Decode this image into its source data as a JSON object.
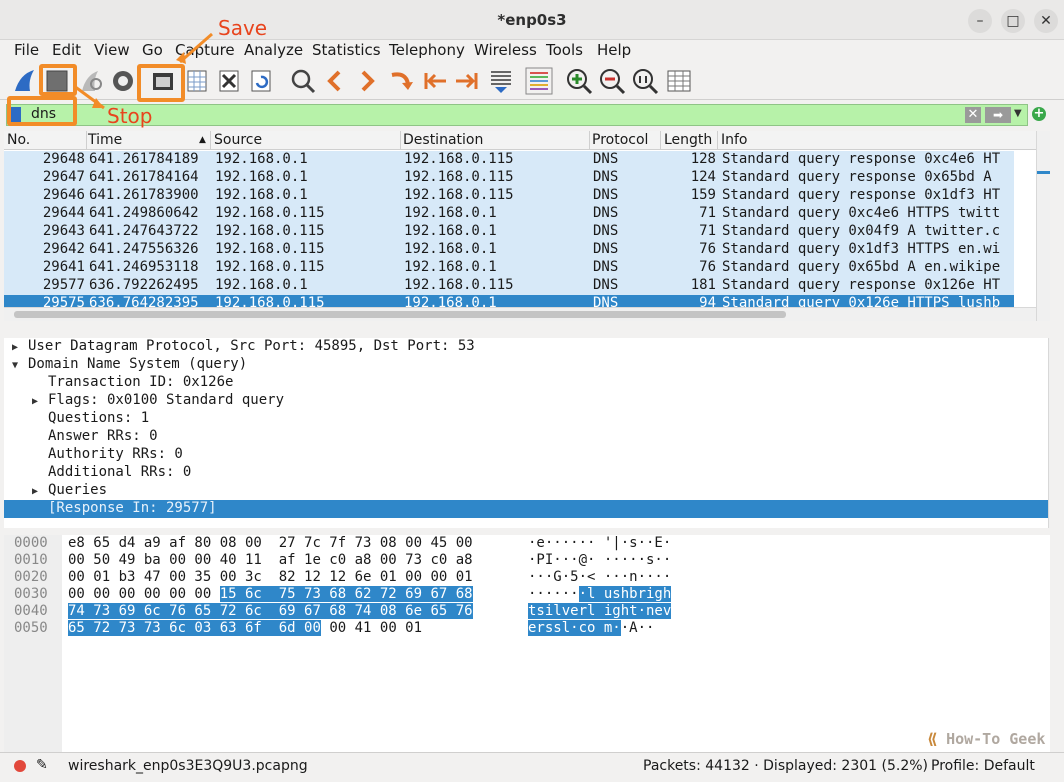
{
  "window": {
    "title": "*enp0s3",
    "minimize": "–",
    "maximize": "□",
    "close": "✕"
  },
  "menu": [
    "File",
    "Edit",
    "View",
    "Go",
    "Capture",
    "Analyze",
    "Statistics",
    "Telephony",
    "Wireless",
    "Tools",
    "Help"
  ],
  "filter": {
    "value": "dns"
  },
  "columns": [
    "No.",
    "Time",
    "Source",
    "Destination",
    "Protocol",
    "Length",
    "Info"
  ],
  "packets": [
    {
      "no": "29648",
      "time": "641.261784189",
      "src": "192.168.0.1",
      "dst": "192.168.0.115",
      "proto": "DNS",
      "len": "128",
      "info": "Standard query response 0xc4e6 HT"
    },
    {
      "no": "29647",
      "time": "641.261784164",
      "src": "192.168.0.1",
      "dst": "192.168.0.115",
      "proto": "DNS",
      "len": "124",
      "info": "Standard query response 0x65bd A"
    },
    {
      "no": "29646",
      "time": "641.261783900",
      "src": "192.168.0.1",
      "dst": "192.168.0.115",
      "proto": "DNS",
      "len": "159",
      "info": "Standard query response 0x1df3 HT"
    },
    {
      "no": "29644",
      "time": "641.249860642",
      "src": "192.168.0.115",
      "dst": "192.168.0.1",
      "proto": "DNS",
      "len": "71",
      "info": "Standard query 0xc4e6 HTTPS twitt"
    },
    {
      "no": "29643",
      "time": "641.247643722",
      "src": "192.168.0.115",
      "dst": "192.168.0.1",
      "proto": "DNS",
      "len": "71",
      "info": "Standard query 0x04f9 A twitter.c"
    },
    {
      "no": "29642",
      "time": "641.247556326",
      "src": "192.168.0.115",
      "dst": "192.168.0.1",
      "proto": "DNS",
      "len": "76",
      "info": "Standard query 0x1df3 HTTPS en.wi"
    },
    {
      "no": "29641",
      "time": "641.246953118",
      "src": "192.168.0.115",
      "dst": "192.168.0.1",
      "proto": "DNS",
      "len": "76",
      "info": "Standard query 0x65bd A en.wikipe"
    },
    {
      "no": "29577",
      "time": "636.792262495",
      "src": "192.168.0.1",
      "dst": "192.168.0.115",
      "proto": "DNS",
      "len": "181",
      "info": "Standard query response 0x126e HT"
    },
    {
      "no": "29575",
      "time": "636.764282395",
      "src": "192.168.0.115",
      "dst": "192.168.0.1",
      "proto": "DNS",
      "len": "94",
      "info": "Standard query 0x126e HTTPS lushb"
    },
    {
      "no": "29493",
      "time": "634.096511346",
      "src": "192.168.0.1",
      "dst": "192.168.0.115",
      "proto": "DNS",
      "len": "138",
      "info": "Standard query response 0xe8fe A"
    }
  ],
  "details": [
    "User Datagram Protocol, Src Port: 45895, Dst Port: 53",
    "Domain Name System (query)",
    "Transaction ID: 0x126e",
    "Flags: 0x0100 Standard query",
    "Questions: 1",
    "Answer RRs: 0",
    "Authority RRs: 0",
    "Additional RRs: 0",
    "Queries",
    "[Response In: 29577]"
  ],
  "bytes": {
    "offsets": [
      "0000",
      "0010",
      "0020",
      "0030",
      "0040",
      "0050"
    ],
    "hex": [
      [
        "e8 65 d4 a9 af 80 08 00",
        "27 7c 7f 73 08 00 45 00"
      ],
      [
        "00 50 49 ba 00 00 40 11",
        "af 1e c0 a8 00 73 c0 a8"
      ],
      [
        "00 01 b3 47 00 35 00 3c",
        "82 12 12 6e 01 00 00 01"
      ],
      [
        "00 00 00 00 00 00 ",
        "15 6c",
        "75 73 68 62 72 69 67 68"
      ],
      [
        "74 73 69 6c 76 65 72 6c",
        "69 67 68 74 08 6e 65 76"
      ],
      [
        "65 72 73 73 6c 03 63 6f",
        "6d 00",
        " 00 41 00 01"
      ]
    ],
    "ascii": [
      "·e······ '|·s··E·",
      "·PI···@· ·····s··",
      "···G·5·< ···n····",
      [
        "······",
        "·l ushbrigh"
      ],
      [
        "tsilverl ight·nev"
      ],
      [
        "erssl·co m·",
        "·A··"
      ]
    ]
  },
  "status": {
    "file": "wireshark_enp0s3E3Q9U3.pcapng",
    "packets": "Packets: 44132 · Displayed: 2301 (5.2%)",
    "profile": "Profile: Default"
  },
  "annotations": {
    "save": "Save",
    "stop": "Stop"
  },
  "watermark": "How-To Geek",
  "colors": {
    "accent": "#f28c28",
    "selection": "#2f87c9",
    "filter_ok": "#b7f2a9",
    "row": "#d7e9f8"
  }
}
